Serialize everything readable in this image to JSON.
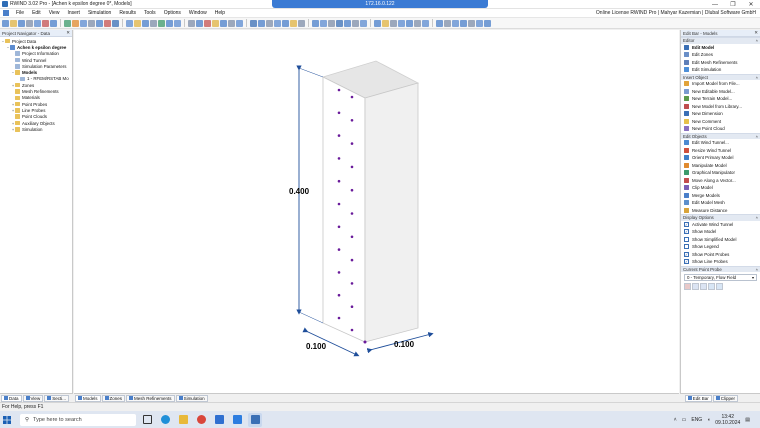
{
  "window": {
    "title": "RWIND 3.02 Pro - [Achen  k epsilon degree 0*, Models]",
    "remote_host": "172.16.0.122",
    "license": "Online License RWIND Pro | Mahyar Kazemian | Dlubal Software GmbH"
  },
  "menu": [
    "File",
    "Edit",
    "View",
    "Insert",
    "Simulation",
    "Results",
    "Tools",
    "Options",
    "Window",
    "Help"
  ],
  "navigator": {
    "title": "Project Navigator - Data",
    "items": [
      {
        "label": "Project Data",
        "level": 0,
        "icon": "folder-icon",
        "expander": "−",
        "bold": false
      },
      {
        "label": "Achen  k epsilon degree",
        "level": 1,
        "icon": "project-icon",
        "expander": "−",
        "bold": true
      },
      {
        "label": "Project Information",
        "level": 2,
        "icon": "document-icon",
        "expander": "",
        "bold": false
      },
      {
        "label": "Wind Tunnel",
        "level": 2,
        "icon": "document-icon",
        "expander": "",
        "bold": false
      },
      {
        "label": "Simulation Parameters",
        "level": 2,
        "icon": "document-icon",
        "expander": "",
        "bold": false
      },
      {
        "label": "Models",
        "level": 2,
        "icon": "folder-icon",
        "expander": "−",
        "bold": true
      },
      {
        "label": "1 - RFEM/RSTAB Mo",
        "level": 3,
        "icon": "model-icon",
        "expander": "",
        "bold": false
      },
      {
        "label": "Zones",
        "level": 2,
        "icon": "folder-icon",
        "expander": "+",
        "bold": false
      },
      {
        "label": "Mesh Refinements",
        "level": 2,
        "icon": "folder-icon",
        "expander": "",
        "bold": false
      },
      {
        "label": "Materials",
        "level": 2,
        "icon": "folder-icon",
        "expander": "",
        "bold": false
      },
      {
        "label": "Point Probes",
        "level": 2,
        "icon": "folder-icon",
        "expander": "+",
        "bold": false
      },
      {
        "label": "Line Probes",
        "level": 2,
        "icon": "folder-icon",
        "expander": "+",
        "bold": false
      },
      {
        "label": "Point Clouds",
        "level": 2,
        "icon": "folder-icon",
        "expander": "",
        "bold": false
      },
      {
        "label": "Auxiliary Objects",
        "level": 2,
        "icon": "folder-icon",
        "expander": "+",
        "bold": false
      },
      {
        "label": "Simulation",
        "level": 2,
        "icon": "folder-icon",
        "expander": "+",
        "bold": false
      }
    ],
    "tabs": [
      {
        "label": "Data",
        "icon": "data-icon",
        "active": true
      },
      {
        "label": "View",
        "icon": "view-icon",
        "active": false
      },
      {
        "label": "Secti...",
        "icon": "sections-icon",
        "active": false
      }
    ]
  },
  "viewport": {
    "dimension_height": "0.400",
    "dimension_width_left": "0.100",
    "dimension_width_right": "0.100",
    "tabs": [
      {
        "label": "Models",
        "icon": "models-icon",
        "active": true
      },
      {
        "label": "Zones",
        "icon": "zones-icon",
        "active": false
      },
      {
        "label": "Mesh Refinements",
        "icon": "mesh-icon",
        "active": false
      },
      {
        "label": "Simulation",
        "icon": "simulation-icon",
        "active": false
      }
    ]
  },
  "editbar": {
    "title": "Edit Bar - Models",
    "sections": [
      {
        "title": "Editor",
        "items": [
          {
            "label": "Edit Model",
            "bold": true,
            "icon": "edit-model-icon",
            "color": "#3a6fb5"
          },
          {
            "label": "Edit Zones",
            "bold": false,
            "icon": "edit-zones-icon",
            "color": "#6a8fc7"
          },
          {
            "label": "Edit Mesh Refinements",
            "bold": false,
            "icon": "edit-mesh-icon",
            "color": "#5e7fb8"
          },
          {
            "label": "Edit Simulation",
            "bold": false,
            "icon": "edit-simulation-icon",
            "color": "#4d8fd8"
          }
        ]
      },
      {
        "title": "Insert Object",
        "items": [
          {
            "label": "Import Model from File...",
            "bold": false,
            "icon": "import-icon",
            "color": "#e1a33a"
          },
          {
            "label": "New Editable Model...",
            "bold": false,
            "icon": "editable-model-icon",
            "color": "#7b9bd0"
          },
          {
            "label": "New Terrain Model...",
            "bold": false,
            "icon": "terrain-icon",
            "color": "#5c9a4a"
          },
          {
            "label": "New Model from Library...",
            "bold": false,
            "icon": "library-icon",
            "color": "#c04d4d"
          },
          {
            "label": "New Dimension",
            "bold": false,
            "icon": "dimension-icon",
            "color": "#3a6fb5"
          },
          {
            "label": "New Comment",
            "bold": false,
            "icon": "comment-icon",
            "color": "#e7c14a"
          },
          {
            "label": "New Point Cloud",
            "bold": false,
            "icon": "point-cloud-icon",
            "color": "#8a6fc0"
          }
        ]
      },
      {
        "title": "Edit Objects",
        "items": [
          {
            "label": "Edit Wind Tunnel...",
            "bold": false,
            "icon": "wind-tunnel-icon",
            "color": "#4b8ad1"
          },
          {
            "label": "Resize Wind Tunnel",
            "bold": false,
            "icon": "resize-icon",
            "color": "#d0503c"
          },
          {
            "label": "Orient Primary Model",
            "bold": false,
            "icon": "orient-icon",
            "color": "#3f7fc7"
          },
          {
            "label": "Manipulate Model",
            "bold": false,
            "icon": "manipulate-icon",
            "color": "#e08a2e"
          },
          {
            "label": "Graphical Manipulator",
            "bold": false,
            "icon": "manipulator-icon",
            "color": "#3c9a6a"
          },
          {
            "label": "Move Along a Vector...",
            "bold": false,
            "icon": "move-vector-icon",
            "color": "#c44d4d"
          },
          {
            "label": "Clip Model",
            "bold": false,
            "icon": "clip-icon",
            "color": "#7a5fb5"
          },
          {
            "label": "Merge Models",
            "bold": false,
            "icon": "merge-icon",
            "color": "#4a7fc9"
          },
          {
            "label": "Edit Model Mesh",
            "bold": false,
            "icon": "model-mesh-icon",
            "color": "#5c8fcc"
          },
          {
            "label": "Measure Distance",
            "bold": false,
            "icon": "measure-icon",
            "color": "#d9a43a"
          }
        ]
      }
    ],
    "display_options": {
      "title": "Display Options",
      "items": [
        {
          "label": "Activate Wind Tunnel",
          "checked": true
        },
        {
          "label": "Show Model",
          "checked": true
        },
        {
          "label": "Show Simplified Model",
          "checked": false
        },
        {
          "label": "Show Legend",
          "checked": false
        },
        {
          "label": "Show Point Probes",
          "checked": true
        },
        {
          "label": "Show Line Probes",
          "checked": true
        }
      ]
    },
    "current_probe": {
      "title": "Current Point Probe",
      "value": "0 - Temporary, Flow Field"
    },
    "tabs": [
      {
        "label": "Edit Bar",
        "icon": "editbar-icon",
        "active": true
      },
      {
        "label": "Clipper",
        "icon": "clipper-icon",
        "active": false
      }
    ]
  },
  "status": {
    "text": "For Help, press F1"
  },
  "taskbar": {
    "search_placeholder": "Type here to search",
    "language": "ENG",
    "time": "13:42",
    "date": "09.10.2024"
  }
}
